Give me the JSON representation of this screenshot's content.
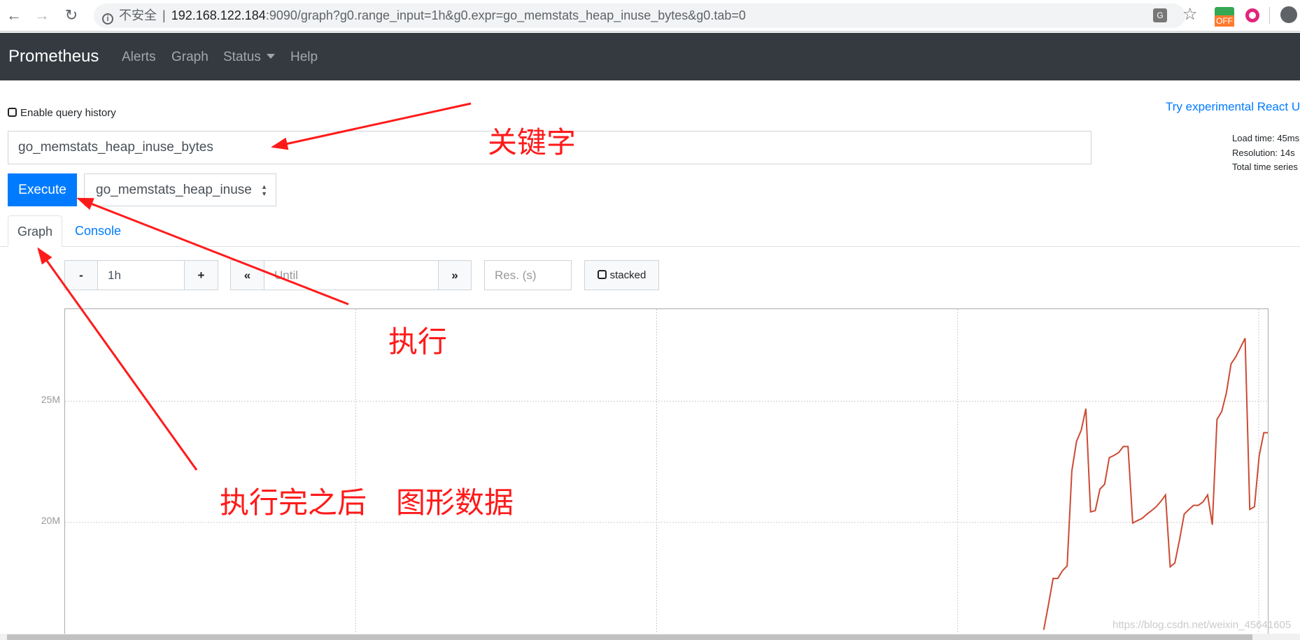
{
  "browser": {
    "security_label": "不安全",
    "url_host": "192.168.122.184",
    "url_rest": ":9090/graph?g0.range_input=1h&g0.expr=go_memstats_heap_inuse_bytes&g0.tab=0",
    "extension_badge": "OFF"
  },
  "navbar": {
    "brand": "Prometheus",
    "links": [
      "Alerts",
      "Graph",
      "Status",
      "Help"
    ]
  },
  "query": {
    "history_label": "Enable query history",
    "react_link": "Try experimental React U",
    "expression": "go_memstats_heap_inuse_bytes",
    "execute_label": "Execute",
    "metric_select": "go_memstats_heap_inuse",
    "stats": [
      "Load time: 45ms",
      "Resolution: 14s",
      "Total time series"
    ]
  },
  "tabs": [
    {
      "label": "Graph",
      "active": true
    },
    {
      "label": "Console",
      "active": false
    }
  ],
  "controls": {
    "minus": "-",
    "range": "1h",
    "plus": "+",
    "until_placeholder": "Until",
    "res_placeholder": "Res. (s)",
    "stacked_label": "stacked"
  },
  "chart_data": {
    "type": "line",
    "range": "1h",
    "resolution_s": 14,
    "series_color": "#cb4b34",
    "grid": true,
    "yticks": [
      {
        "value": 25,
        "label": "25M"
      },
      {
        "value": 20,
        "label": "20M"
      }
    ],
    "ylim": [
      15.4,
      28.8
    ],
    "values": [
      15.56,
      16.59,
      17.68,
      17.68,
      18.0,
      18.2,
      22.12,
      23.34,
      23.8,
      24.69,
      20.43,
      20.48,
      21.37,
      21.57,
      22.67,
      22.76,
      22.88,
      23.13,
      23.13,
      19.97,
      20.07,
      20.16,
      20.33,
      20.48,
      20.64,
      20.86,
      21.13,
      18.16,
      18.32,
      19.28,
      20.34,
      20.53,
      20.7,
      20.7,
      20.84,
      21.13,
      19.9,
      24.25,
      24.57,
      25.34,
      26.54,
      26.83,
      27.21,
      27.6,
      20.53,
      20.64,
      22.74,
      23.7,
      23.7
    ]
  },
  "annotations": {
    "keyword": "关键字",
    "execute": "执行",
    "result": "执行完之后　图形数据",
    "color": "#ff1a1a"
  },
  "watermark": "https://blog.csdn.net/weixin_45641605"
}
